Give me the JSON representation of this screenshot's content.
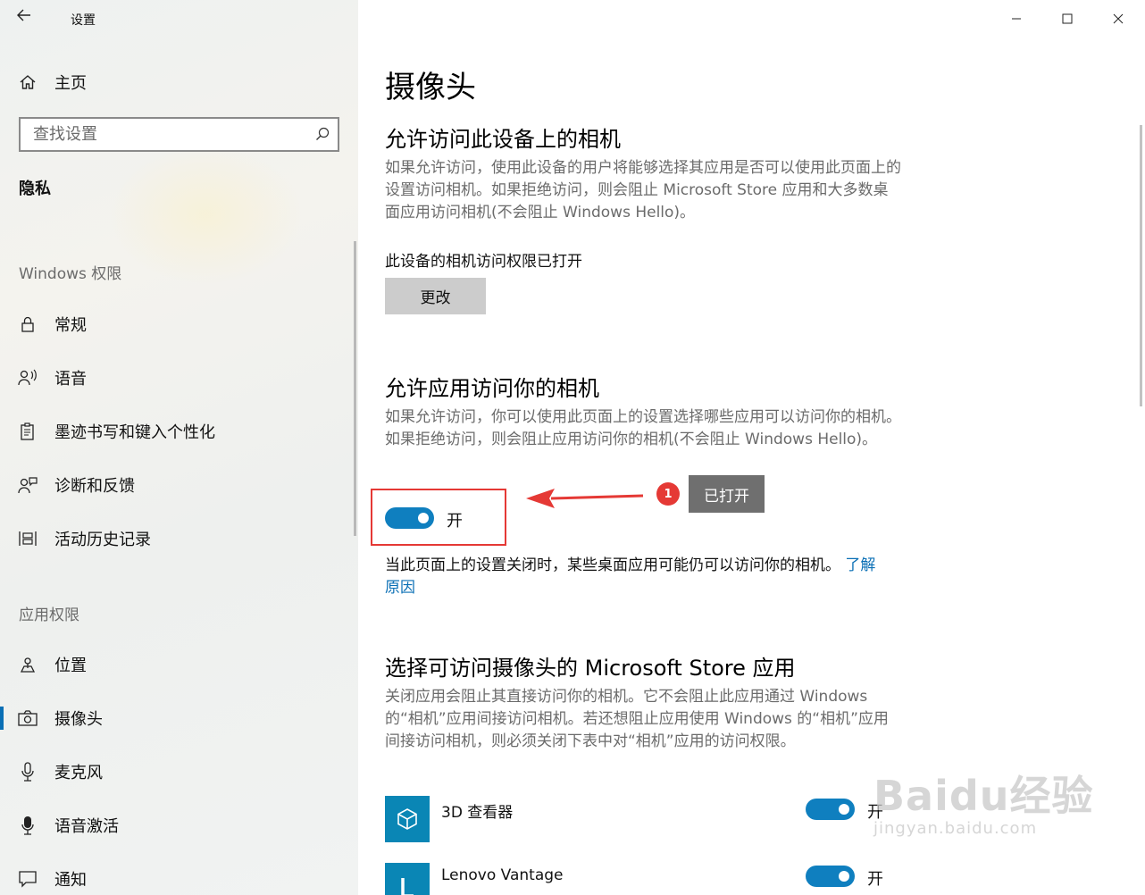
{
  "window": {
    "title": "设置"
  },
  "sidebar": {
    "home_label": "主页",
    "search_placeholder": "查找设置",
    "category": "隐私",
    "section_windows": "Windows 权限",
    "windows_items": [
      {
        "label": "常规",
        "icon": "lock-icon"
      },
      {
        "label": "语音",
        "icon": "speech-icon"
      },
      {
        "label": "墨迹书写和键入个性化",
        "icon": "clipboard-pen-icon"
      },
      {
        "label": "诊断和反馈",
        "icon": "feedback-person-icon"
      },
      {
        "label": "活动历史记录",
        "icon": "timeline-icon"
      }
    ],
    "section_apps": "应用权限",
    "app_items": [
      {
        "label": "位置",
        "icon": "location-icon"
      },
      {
        "label": "摄像头",
        "icon": "camera-icon",
        "active": true
      },
      {
        "label": "麦克风",
        "icon": "microphone-icon"
      },
      {
        "label": "语音激活",
        "icon": "voice-activation-icon"
      },
      {
        "label": "通知",
        "icon": "notification-icon"
      }
    ]
  },
  "main": {
    "page_title": "摄像头",
    "device_section": {
      "heading": "允许访问此设备上的相机",
      "description": "如果允许访问，使用此设备的用户将能够选择其应用是否可以使用此页面上的设置访问相机。如果拒绝访问，则会阻止 Microsoft Store 应用和大多数桌面应用访问相机(不会阻止 Windows Hello)。",
      "status": "此设备的相机访问权限已打开",
      "change_button": "更改"
    },
    "apps_section": {
      "heading": "允许应用访问你的相机",
      "description": "如果允许访问，你可以使用此页面上的设置选择哪些应用可以访问你的相机。如果拒绝访问，则会阻止应用访问你的相机(不会阻止 Windows Hello)。",
      "toggle_state": "开",
      "toggle_on": true,
      "note_text": "当此页面上的设置关闭时，某些桌面应用可能仍可以访问你的相机。",
      "learn_more": "了解原因"
    },
    "annotation": {
      "number": "1",
      "tooltip": "已打开",
      "color": "#e53935"
    },
    "store_section": {
      "heading": "选择可访问摄像头的 Microsoft Store 应用",
      "description": "关闭应用会阻止其直接访问你的相机。它不会阻止此应用通过 Windows 的“相机”应用间接访问相机。若还想阻止应用使用 Windows 的“相机”应用间接访问相机，则必须关闭下表中对“相机”应用的访问权限。",
      "apps": [
        {
          "name": "3D 查看器",
          "state": "开",
          "on": true,
          "icon": "cube-icon"
        },
        {
          "name": "Lenovo Vantage",
          "state": "开",
          "on": true,
          "icon": "lenovo-l-icon"
        }
      ]
    }
  },
  "watermark": {
    "main": "Baidu经验",
    "sub": "jingyan.baidu.com"
  },
  "colors": {
    "accent": "#0f7fbf",
    "link": "#0a6fb5",
    "highlight": "#e53935"
  }
}
